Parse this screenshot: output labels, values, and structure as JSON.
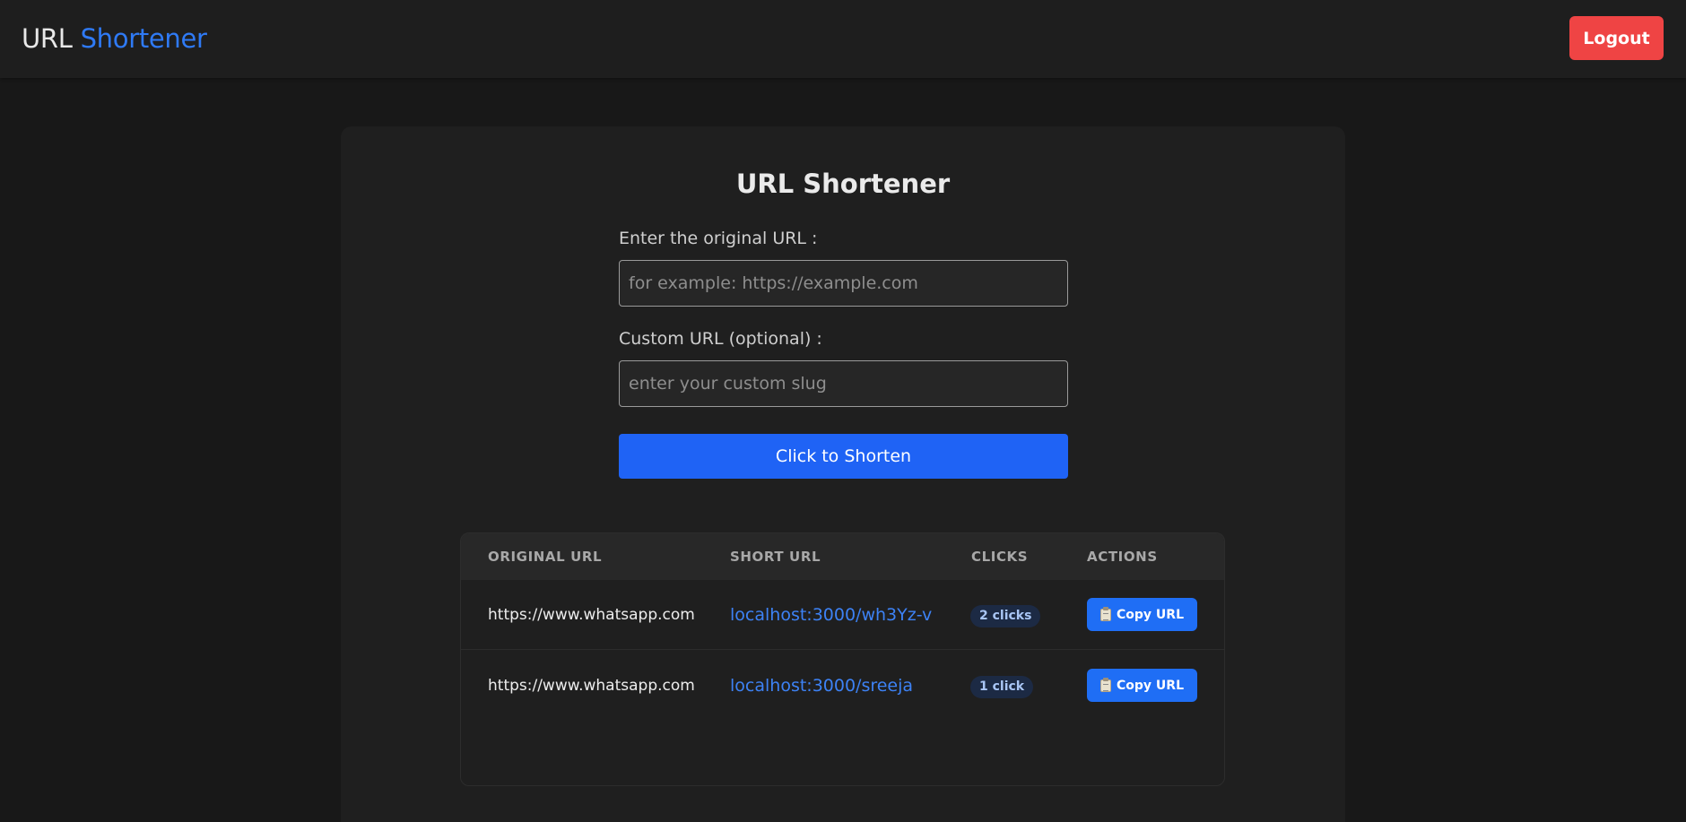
{
  "header": {
    "brand_part1": "URL",
    "brand_part2": "Shortener",
    "logout_label": "Logout"
  },
  "form": {
    "title": "URL Shortener",
    "original_url_label": "Enter the original URL :",
    "original_url_placeholder": "for example: https://example.com",
    "original_url_value": "",
    "custom_url_label": "Custom URL (optional) :",
    "custom_url_placeholder": "enter your custom slug",
    "custom_url_value": "",
    "submit_label": "Click to Shorten"
  },
  "table": {
    "columns": [
      "ORIGINAL URL",
      "SHORT URL",
      "CLICKS",
      "ACTIONS"
    ],
    "rows": [
      {
        "original": "https://www.whatsapp.com",
        "short": "localhost:3000/wh3Yz-v",
        "clicks": "2 clicks",
        "action": "Copy URL"
      },
      {
        "original": "https://www.whatsapp.com",
        "short": "localhost:3000/sreeja",
        "clicks": "1 click",
        "action": "Copy URL"
      }
    ]
  },
  "colors": {
    "accent": "#2f7af5",
    "logout": "#ef4444",
    "button": "#1f63f5",
    "background": "#181818"
  },
  "icons": {
    "copy": "clipboard-icon"
  }
}
